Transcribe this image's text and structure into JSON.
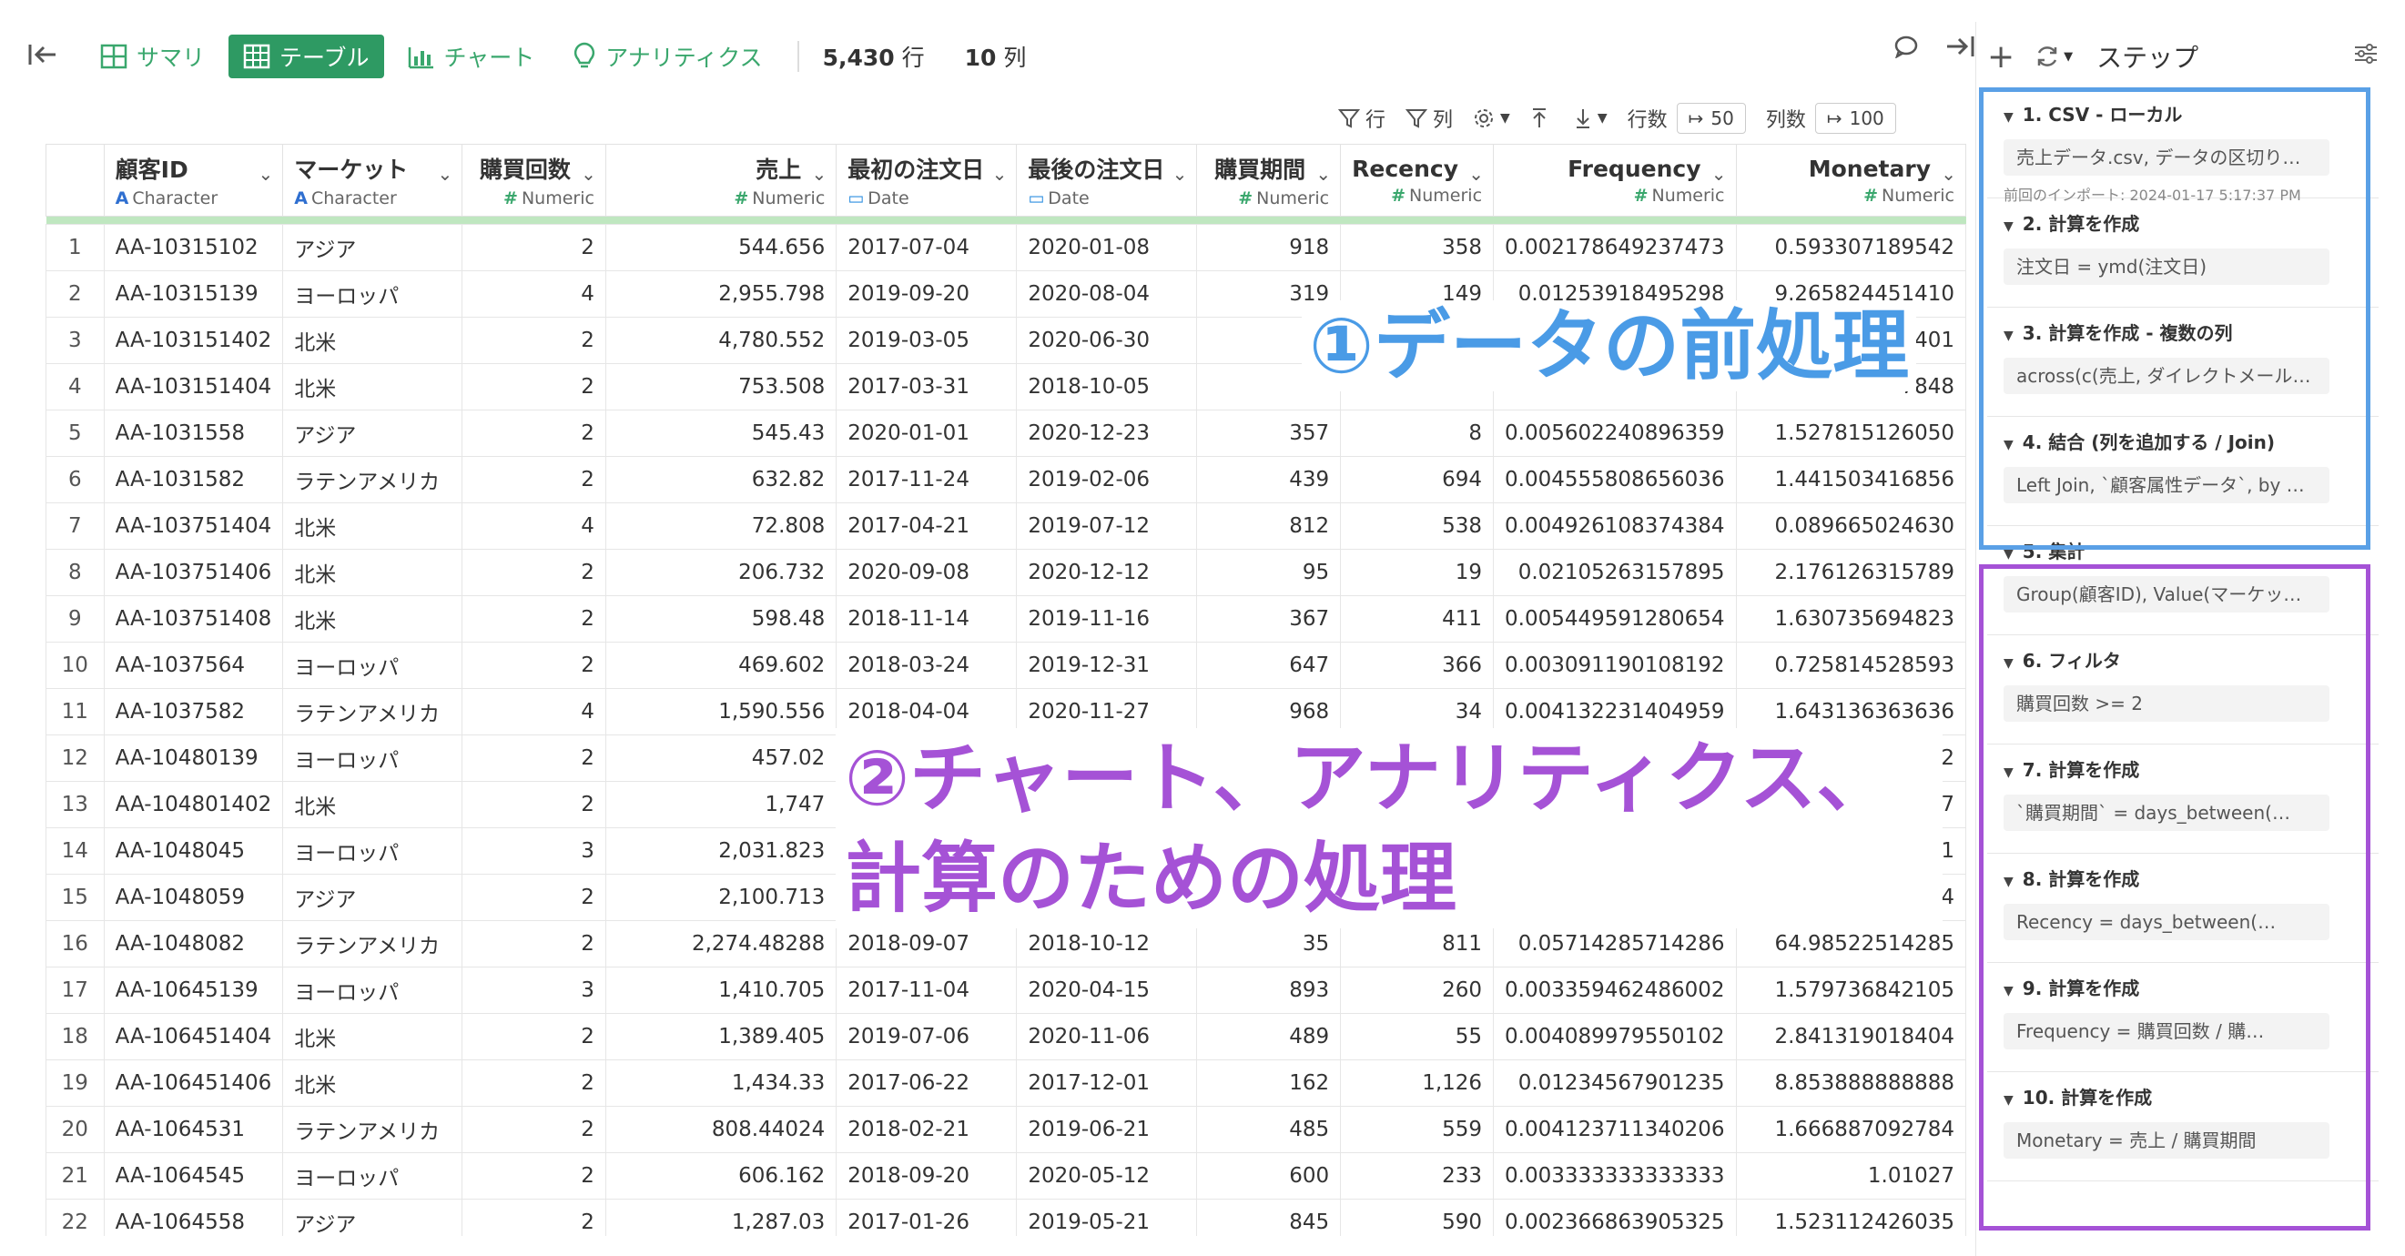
{
  "toolbar": {
    "summary": "サマリ",
    "table": "テーブル",
    "chart": "チャート",
    "analytics": "アナリティクス",
    "rows_count": "5,430",
    "rows_unit": "行",
    "cols_count": "10",
    "cols_unit": "列"
  },
  "subtoolbar": {
    "row_filter": "行",
    "col_filter": "列",
    "rows_label": "行数",
    "rows_value": "50",
    "cols_label": "列数",
    "cols_value": "100"
  },
  "columns": [
    {
      "name": "顧客ID",
      "type": "Character",
      "icon": "A"
    },
    {
      "name": "マーケット",
      "type": "Character",
      "icon": "A"
    },
    {
      "name": "購買回数",
      "type": "Numeric",
      "icon": "#"
    },
    {
      "name": "売上",
      "type": "Numeric",
      "icon": "#"
    },
    {
      "name": "最初の注文日",
      "type": "Date",
      "icon": "date"
    },
    {
      "name": "最後の注文日",
      "type": "Date",
      "icon": "date"
    },
    {
      "name": "購買期間",
      "type": "Numeric",
      "icon": "#"
    },
    {
      "name": "Recency",
      "type": "Numeric",
      "icon": "#"
    },
    {
      "name": "Frequency",
      "type": "Numeric",
      "icon": "#"
    },
    {
      "name": "Monetary",
      "type": "Numeric",
      "icon": "#"
    }
  ],
  "rows": [
    [
      "1",
      "AA-10315102",
      "アジア",
      "2",
      "544.656",
      "2017-07-04",
      "2020-01-08",
      "918",
      "358",
      "0.002178649237473",
      "0.593307189542"
    ],
    [
      "2",
      "AA-10315139",
      "ヨーロッパ",
      "4",
      "2,955.798",
      "2019-09-20",
      "2020-08-04",
      "319",
      "149",
      "0.01253918495298",
      "9.265824451410"
    ],
    [
      "3",
      "AA-103151402",
      "北米",
      "2",
      "4,780.552",
      "2019-03-05",
      "2020-06-30",
      "",
      "",
      "",
      "8401"
    ],
    [
      "4",
      "AA-103151404",
      "北米",
      "2",
      "753.508",
      "2017-03-31",
      "2018-10-05",
      "",
      "",
      "",
      "7848"
    ],
    [
      "5",
      "AA-1031558",
      "アジア",
      "2",
      "545.43",
      "2020-01-01",
      "2020-12-23",
      "357",
      "8",
      "0.005602240896359",
      "1.527815126050"
    ],
    [
      "6",
      "AA-1031582",
      "ラテンアメリカ",
      "2",
      "632.82",
      "2017-11-24",
      "2019-02-06",
      "439",
      "694",
      "0.004555808656036",
      "1.441503416856"
    ],
    [
      "7",
      "AA-103751404",
      "北米",
      "4",
      "72.808",
      "2017-04-21",
      "2019-07-12",
      "812",
      "538",
      "0.004926108374384",
      "0.089665024630"
    ],
    [
      "8",
      "AA-103751406",
      "北米",
      "2",
      "206.732",
      "2020-09-08",
      "2020-12-12",
      "95",
      "19",
      "0.02105263157895",
      "2.176126315789"
    ],
    [
      "9",
      "AA-103751408",
      "北米",
      "2",
      "598.48",
      "2018-11-14",
      "2019-11-16",
      "367",
      "411",
      "0.005449591280654",
      "1.630735694823"
    ],
    [
      "10",
      "AA-1037564",
      "ヨーロッパ",
      "2",
      "469.602",
      "2018-03-24",
      "2019-12-31",
      "647",
      "366",
      "0.003091190108192",
      "0.725814528593"
    ],
    [
      "11",
      "AA-1037582",
      "ラテンアメリカ",
      "4",
      "1,590.556",
      "2018-04-04",
      "2020-11-27",
      "968",
      "34",
      "0.004132231404959",
      "1.643136363636"
    ],
    [
      "12",
      "AA-10480139",
      "ヨーロッパ",
      "2",
      "457.02",
      "",
      "",
      "",
      "",
      "",
      "5702"
    ],
    [
      "13",
      "AA-104801402",
      "北米",
      "2",
      "1,747",
      "",
      "",
      "",
      "",
      "",
      "687"
    ],
    [
      "14",
      "AA-1048045",
      "ヨーロッパ",
      "3",
      "2,031.823",
      "",
      "",
      "",
      "",
      "",
      "881"
    ],
    [
      "15",
      "AA-1048059",
      "アジア",
      "2",
      "2,100.713",
      "",
      "",
      "",
      "",
      "",
      "4904"
    ],
    [
      "16",
      "AA-1048082",
      "ラテンアメリカ",
      "2",
      "2,274.48288",
      "2018-09-07",
      "2018-10-12",
      "35",
      "811",
      "0.05714285714286",
      "64.98522514285"
    ],
    [
      "17",
      "AA-10645139",
      "ヨーロッパ",
      "3",
      "1,410.705",
      "2017-11-04",
      "2020-04-15",
      "893",
      "260",
      "0.003359462486002",
      "1.579736842105"
    ],
    [
      "18",
      "AA-106451404",
      "北米",
      "2",
      "1,389.405",
      "2019-07-06",
      "2020-11-06",
      "489",
      "55",
      "0.004089979550102",
      "2.841319018404"
    ],
    [
      "19",
      "AA-106451406",
      "北米",
      "2",
      "1,434.33",
      "2017-06-22",
      "2017-12-01",
      "162",
      "1,126",
      "0.01234567901235",
      "8.853888888888"
    ],
    [
      "20",
      "AA-1064531",
      "ラテンアメリカ",
      "2",
      "808.44024",
      "2018-02-21",
      "2019-06-21",
      "485",
      "559",
      "0.004123711340206",
      "1.666887092784"
    ],
    [
      "21",
      "AA-1064545",
      "ヨーロッパ",
      "2",
      "606.162",
      "2018-09-20",
      "2020-05-12",
      "600",
      "233",
      "0.003333333333333",
      "1.01027"
    ],
    [
      "22",
      "AA-1064558",
      "アジア",
      "2",
      "1,287.03",
      "2017-01-26",
      "2019-05-21",
      "845",
      "590",
      "0.002366863905325",
      "1.523112426035"
    ]
  ],
  "panel": {
    "title": "ステップ",
    "steps": [
      {
        "title": "1. CSV - ローカル",
        "content": "売上データ.csv, データの区切り文…",
        "note": "前回のインポート: 2024-01-17 5:17:37 PM"
      },
      {
        "title": "2. 計算を作成",
        "content": "注文日 = ymd(注文日)"
      },
      {
        "title": "3. 計算を作成 - 複数の列",
        "content": "across(c(売上, ダイレクトメール費…"
      },
      {
        "title": "4. 結合 (列を追加する / Join)",
        "content": "Left Join, `顧客属性データ`, by = joi…"
      },
      {
        "title": "5. 集計",
        "content": "Group(顧客ID), Value(マーケット,注…"
      },
      {
        "title": "6. フィルタ",
        "content": "購買回数 >= 2"
      },
      {
        "title": "7. 計算を作成",
        "content": "`購買期間` = days_between(…"
      },
      {
        "title": "8. 計算を作成",
        "content": "Recency = days_between(…"
      },
      {
        "title": "9. 計算を作成",
        "content": "Frequency = 購買回数 / 購…"
      },
      {
        "title": "10. 計算を作成",
        "content": "Monetary = 売上 / 購買期間"
      }
    ]
  },
  "annotations": {
    "a1": "①データの前処理",
    "a2_line1": "②チャート、アナリティクス、",
    "a2_line2": "計算のための処理"
  },
  "colors": {
    "accent_green": "#2e9a63",
    "annotation_blue": "#4a9be6",
    "annotation_purple": "#a552d6"
  }
}
